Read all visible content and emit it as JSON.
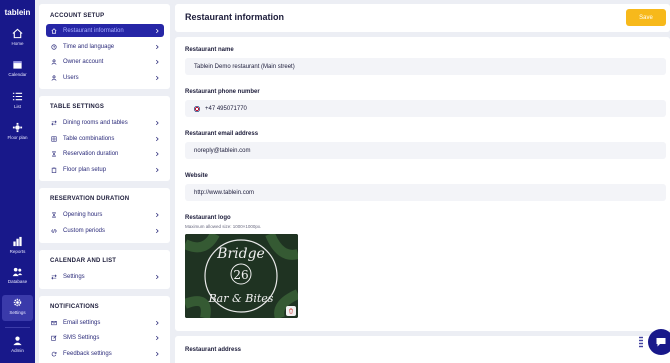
{
  "app": {
    "logo": "tablein"
  },
  "rail": {
    "items": [
      {
        "label": "Home",
        "icon": "home-icon"
      },
      {
        "label": "Calendar",
        "icon": "calendar-icon"
      },
      {
        "label": "List",
        "icon": "list-icon"
      },
      {
        "label": "Floor plan",
        "icon": "floor-plan-icon"
      },
      {
        "label": "Reports",
        "icon": "reports-icon"
      },
      {
        "label": "Database",
        "icon": "database-icon"
      },
      {
        "label": "Settings",
        "icon": "settings-icon",
        "active": true
      },
      {
        "label": "Admin",
        "icon": "admin-icon"
      }
    ]
  },
  "nav": {
    "account": {
      "title": "ACCOUNT SETUP",
      "items": [
        {
          "label": "Restaurant information",
          "active": true
        },
        {
          "label": "Time and language"
        },
        {
          "label": "Owner account"
        },
        {
          "label": "Users"
        }
      ]
    },
    "table": {
      "title": "TABLE SETTINGS",
      "items": [
        {
          "label": "Dining rooms and tables"
        },
        {
          "label": "Table combinations"
        },
        {
          "label": "Reservation duration"
        },
        {
          "label": "Floor plan setup"
        }
      ]
    },
    "duration": {
      "title": "RESERVATION DURATION",
      "items": [
        {
          "label": "Opening hours"
        },
        {
          "label": "Custom periods"
        }
      ]
    },
    "calendar": {
      "title": "CALENDAR AND LIST",
      "items": [
        {
          "label": "Settings"
        }
      ]
    },
    "notifications": {
      "title": "NOTIFICATIONS",
      "items": [
        {
          "label": "Email settings"
        },
        {
          "label": "SMS Settings"
        },
        {
          "label": "Feedback settings"
        }
      ]
    }
  },
  "header": {
    "title": "Restaurant information",
    "save_label": "Save"
  },
  "form": {
    "name_label": "Restaurant name",
    "name_value": "Tablein Demo restaurant (Main street)",
    "phone_label": "Restaurant phone number",
    "phone_value": "+47 495071770",
    "email_label": "Restaurant email address",
    "email_value": "noreply@tablein.com",
    "website_label": "Website",
    "website_value": "http://www.tablein.com",
    "logo_label": "Restaurant logo",
    "logo_hint": "Maximum allowed size: 1000×1000px.",
    "logo_text_top": "Bridge",
    "logo_text_mid": "26",
    "logo_text_bottom": "Bar & Bites",
    "address_label": "Restaurant address"
  },
  "colors": {
    "rail": "#18188a",
    "active_nav": "#2626a6",
    "save": "#f7b91b"
  }
}
